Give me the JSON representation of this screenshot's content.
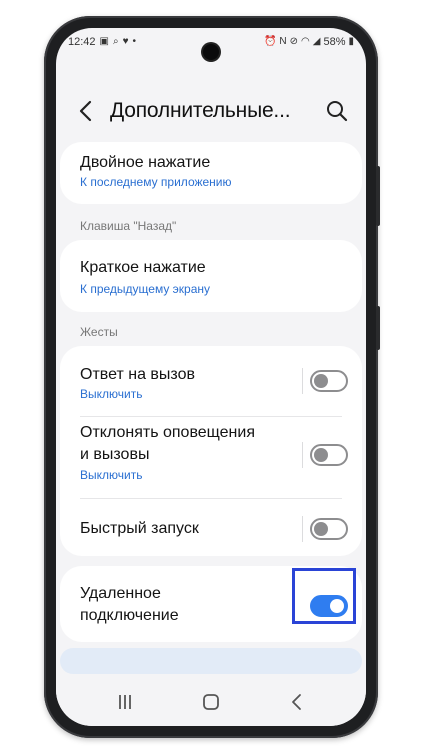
{
  "status_bar": {
    "time": "12:42",
    "battery": "58%",
    "left_icons": [
      "camera-notif-icon",
      "search-notif-icon",
      "heart-icon",
      "dot-icon"
    ],
    "right_icons": [
      "alarm-icon",
      "nfc-icon",
      "mute-icon",
      "wifi-icon",
      "signal-icon",
      "battery-icon"
    ]
  },
  "header": {
    "title": "Дополнительные...",
    "back_icon": "chevron-left-icon",
    "search_icon": "search-icon"
  },
  "recent_card": {
    "double_press": {
      "title": "Двойное нажатие",
      "value": "К последнему приложению"
    }
  },
  "back_key_section": {
    "label": "Клавиша \"Назад\"",
    "short_press": {
      "title": "Краткое нажатие",
      "value": "К предыдущему экрану"
    }
  },
  "gestures_section": {
    "label": "Жесты",
    "items": [
      {
        "title": "Ответ на вызов",
        "value": "Выключить",
        "enabled": false
      },
      {
        "title_line1": "Отклонять оповещения",
        "title_line2": "и вызовы",
        "value": "Выключить",
        "enabled": false
      },
      {
        "title": "Быстрый запуск",
        "enabled": false
      }
    ]
  },
  "remote_card": {
    "title_line1": "Удаленное",
    "title_line2": "подключение",
    "enabled": true
  },
  "colors": {
    "accent": "#2f7df0",
    "link": "#2a6fd1",
    "highlight_border": "#2a44d6"
  },
  "nav": [
    "recents-icon",
    "home-icon",
    "back-icon"
  ]
}
